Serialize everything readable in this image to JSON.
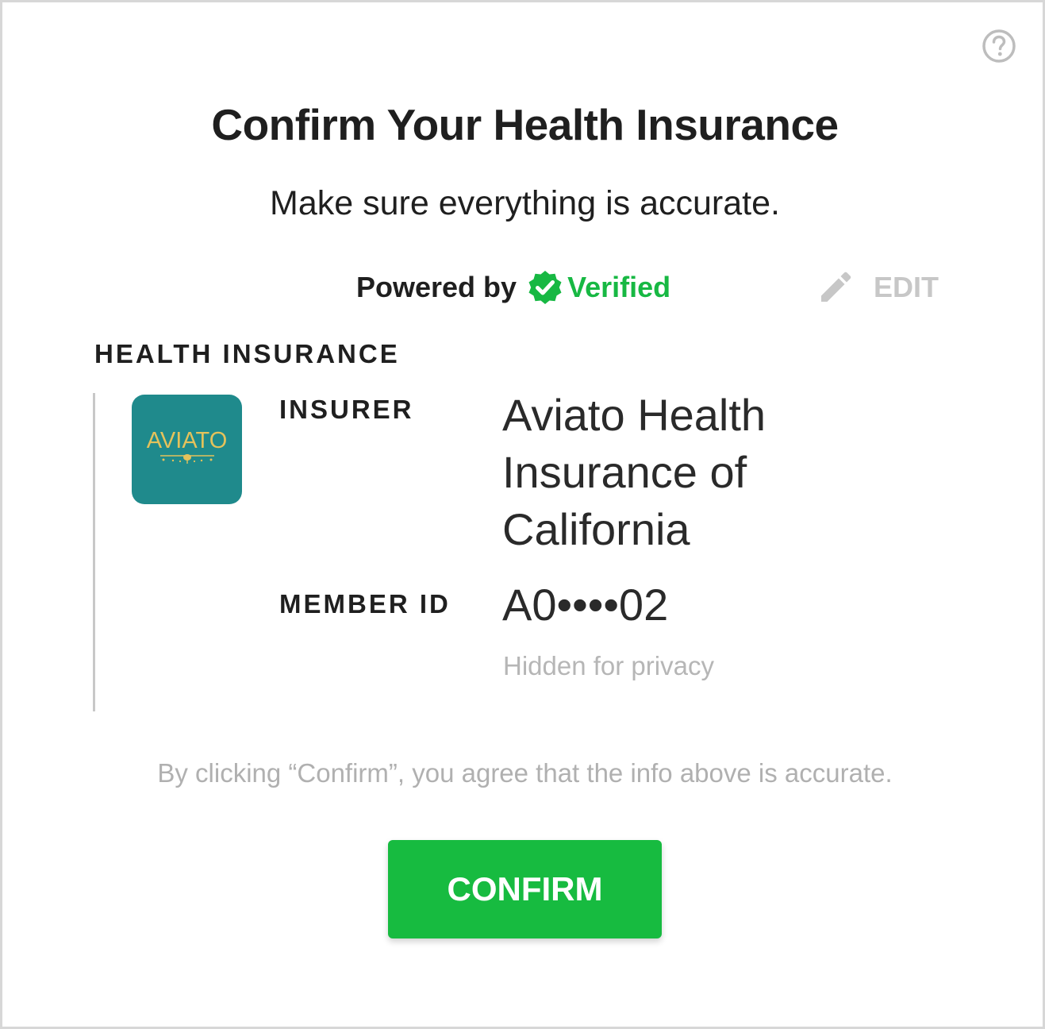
{
  "header": {
    "title": "Confirm Your Health Insurance",
    "subtitle": "Make sure everything is accurate.",
    "help_icon": "question-circle-icon"
  },
  "provider": {
    "powered_by": "Powered by",
    "brand": "Verified",
    "brand_icon": "verified-badge-icon",
    "brand_color": "#17b843"
  },
  "edit": {
    "label": "EDIT",
    "icon": "pencil-icon"
  },
  "section": {
    "title": "HEALTH INSURANCE",
    "insurer_label": "INSURER",
    "insurer_name": "Aviato Health Insurance of California",
    "logo_text": "AVIATO",
    "member_id_label": "MEMBER ID",
    "member_id_value": "A0••••02",
    "member_id_hint": "Hidden for privacy"
  },
  "footer": {
    "disclaimer": "By clicking “Confirm”, you agree that the info above is accurate.",
    "confirm_label": "CONFIRM",
    "confirm_color": "#17bb40"
  }
}
